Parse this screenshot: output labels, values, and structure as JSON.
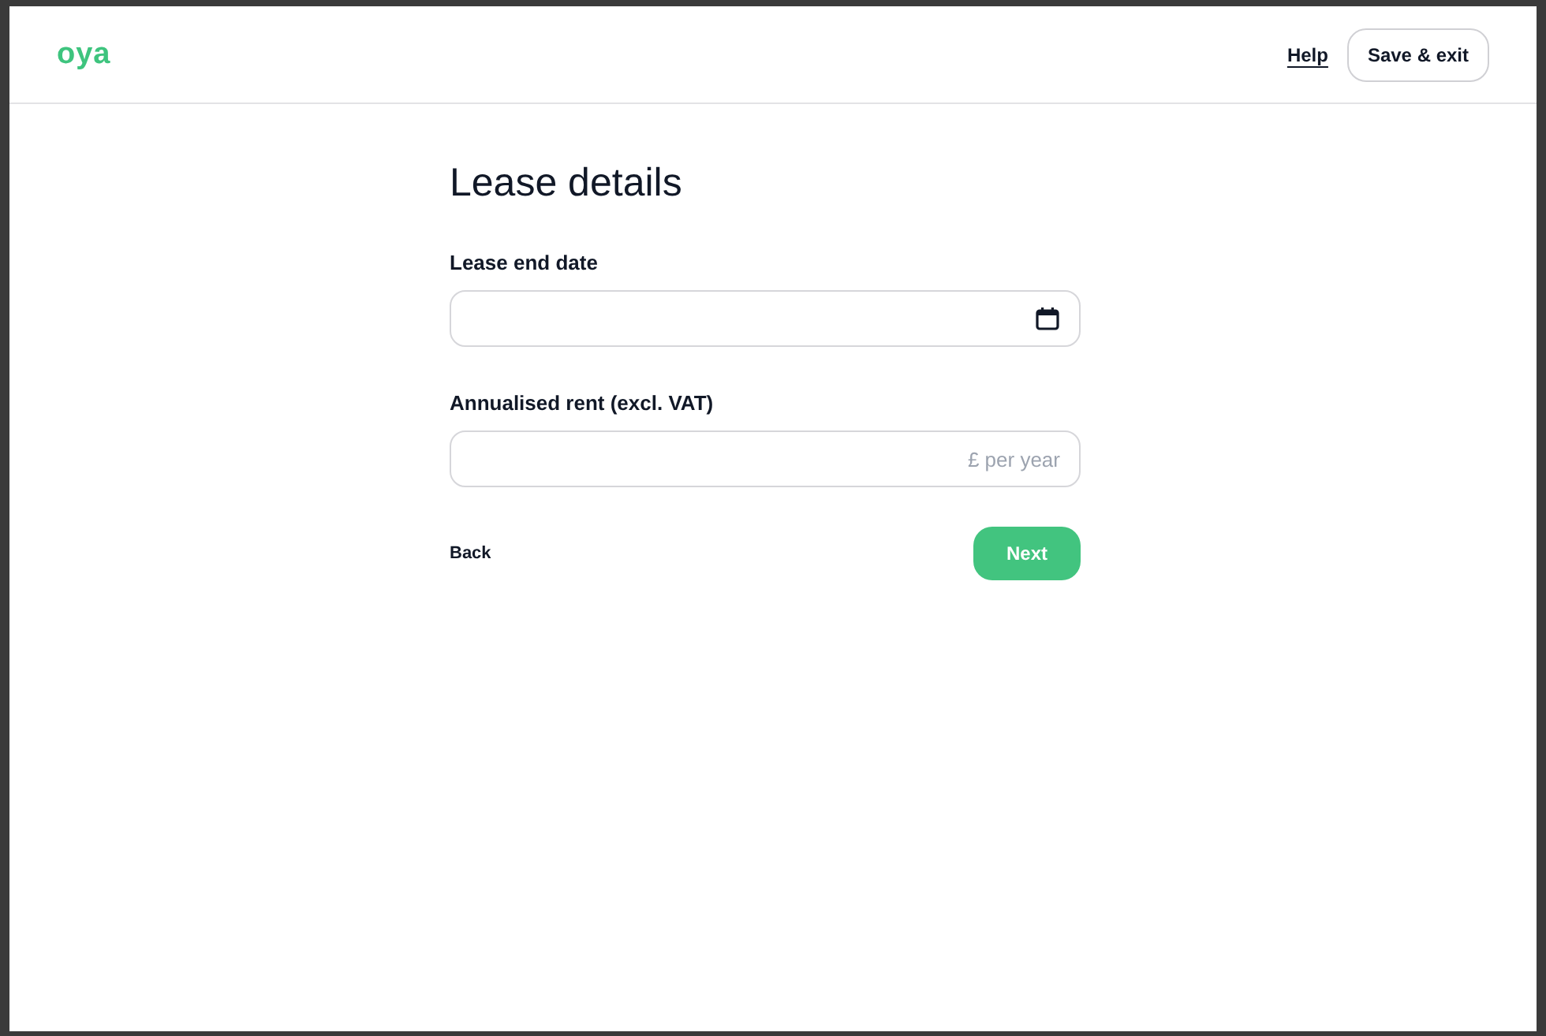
{
  "header": {
    "logo": "oya",
    "help_link": "Help",
    "save_button": "Save & exit"
  },
  "form": {
    "title": "Lease details",
    "fields": [
      {
        "kind": "date",
        "label": "Lease end date"
      },
      {
        "kind": "money",
        "label": "Annualised rent (excl. VAT)",
        "placeholder": "£ per year"
      }
    ],
    "back": "Back",
    "next": "Next"
  }
}
